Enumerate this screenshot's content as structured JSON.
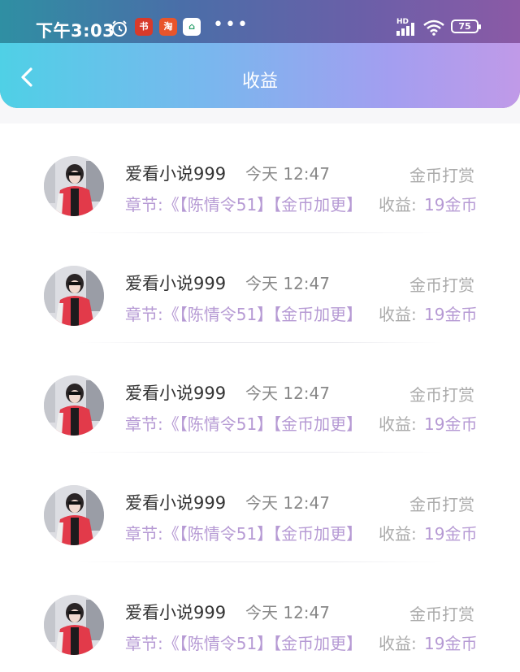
{
  "status_bar": {
    "time": "下午3:03",
    "network": "HD",
    "battery": "75",
    "app_badges": [
      "书",
      "淘",
      "⌂"
    ],
    "more": "•••"
  },
  "header": {
    "title": "收益",
    "back_icon": "chevron-left-icon"
  },
  "colors": {
    "header_gradient_start": "#4fd0e6",
    "header_gradient_end": "#c09ae8",
    "accent_purple": "#b69ad4"
  },
  "records": [
    {
      "user": "爱看小说999",
      "time": "今天 12:47",
      "type": "金币打赏",
      "detail": "章节:《【陈情令51】【金币加更】",
      "earn_label": "收益:",
      "earn_value": "19金币"
    },
    {
      "user": "爱看小说999",
      "time": "今天 12:47",
      "type": "金币打赏",
      "detail": "章节:《【陈情令51】【金币加更】",
      "earn_label": "收益:",
      "earn_value": "19金币"
    },
    {
      "user": "爱看小说999",
      "time": "今天 12:47",
      "type": "金币打赏",
      "detail": "章节:《【陈情令51】【金币加更】",
      "earn_label": "收益:",
      "earn_value": "19金币"
    },
    {
      "user": "爱看小说999",
      "time": "今天 12:47",
      "type": "金币打赏",
      "detail": "章节:《【陈情令51】【金币加更】",
      "earn_label": "收益:",
      "earn_value": "19金币"
    },
    {
      "user": "爱看小说999",
      "time": "今天 12:47",
      "type": "金币打赏",
      "detail": "章节:《【陈情令51】【金币加更】",
      "earn_label": "收益:",
      "earn_value": "19金币"
    }
  ]
}
